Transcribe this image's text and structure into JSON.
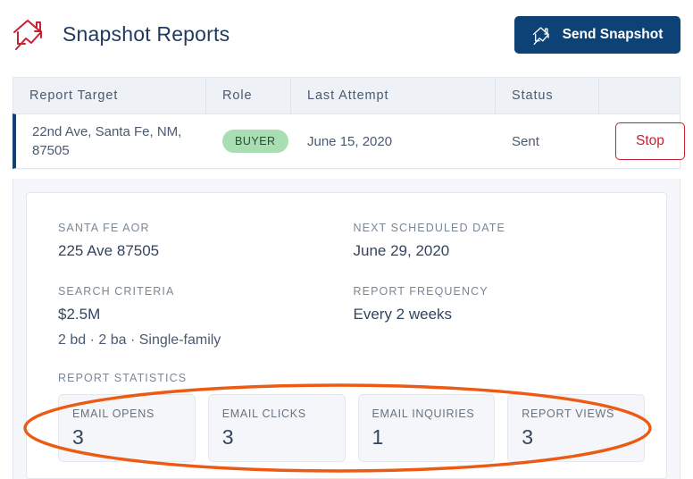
{
  "header": {
    "title": "Snapshot Reports",
    "brand_icon": "house-trending-arrow-icon",
    "send_button": {
      "label": "Send Snapshot",
      "icon": "house-trending-arrow-icon",
      "bg_color": "#0d4277",
      "text_color": "#ffffff"
    }
  },
  "table": {
    "columns": [
      "Report Target",
      "Role",
      "Last Attempt",
      "Status",
      ""
    ],
    "rows": [
      {
        "target": "22nd Ave, Santa Fe, NM, 87505",
        "role": "BUYER",
        "role_badge_color": "#a9deb2",
        "last_attempt": "June 15, 2020",
        "status": "Sent",
        "action_label": "Stop",
        "action_color": "#c52233",
        "accent_color": "#0d4277"
      }
    ]
  },
  "detail": {
    "fields": [
      {
        "label": "SANTA FE AOR",
        "value": "225 Ave 87505"
      },
      {
        "label": "NEXT SCHEDULED DATE",
        "value": "June 29, 2020"
      },
      {
        "label": "SEARCH CRITERIA",
        "value": "$2.5M",
        "value2": "2 bd · 2 ba · Single-family"
      },
      {
        "label": "REPORT FREQUENCY",
        "value": "Every 2 weeks"
      }
    ],
    "statistics": {
      "label": "REPORT STATISTICS",
      "cards": [
        {
          "name": "EMAIL OPENS",
          "value": "3"
        },
        {
          "name": "EMAIL CLICKS",
          "value": "3"
        },
        {
          "name": "EMAIL INQUIRIES",
          "value": "1"
        },
        {
          "name": "REPORT VIEWS",
          "value": "3"
        }
      ]
    }
  },
  "annotation": {
    "shape": "ellipse-highlight",
    "color": "#ec5a13",
    "target": "report-statistics-cards"
  }
}
